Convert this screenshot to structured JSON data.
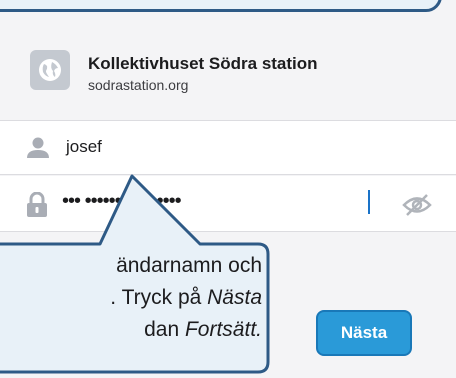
{
  "site": {
    "name": "Kollektivhuset Södra station",
    "url": "sodrastation.org",
    "icon": "globe-icon"
  },
  "username_field": {
    "value": "josef",
    "icon": "person-icon"
  },
  "password_field": {
    "masked_value": "••• ••••••••••••••••",
    "icon": "lock-icon",
    "toggle_icon": "eye-slash-icon"
  },
  "next_button": {
    "label": "Nästa",
    "color": "#2a9ad8"
  },
  "callout": {
    "line1": "ändarnamn och",
    "line2_prefix": ". Tryck på ",
    "line2_emphasis": "Nästa",
    "line3_prefix": "dan ",
    "line3_emphasis": "Fortsätt.",
    "border_color": "#2e5a86",
    "fill_color": "#e8f1f8"
  }
}
